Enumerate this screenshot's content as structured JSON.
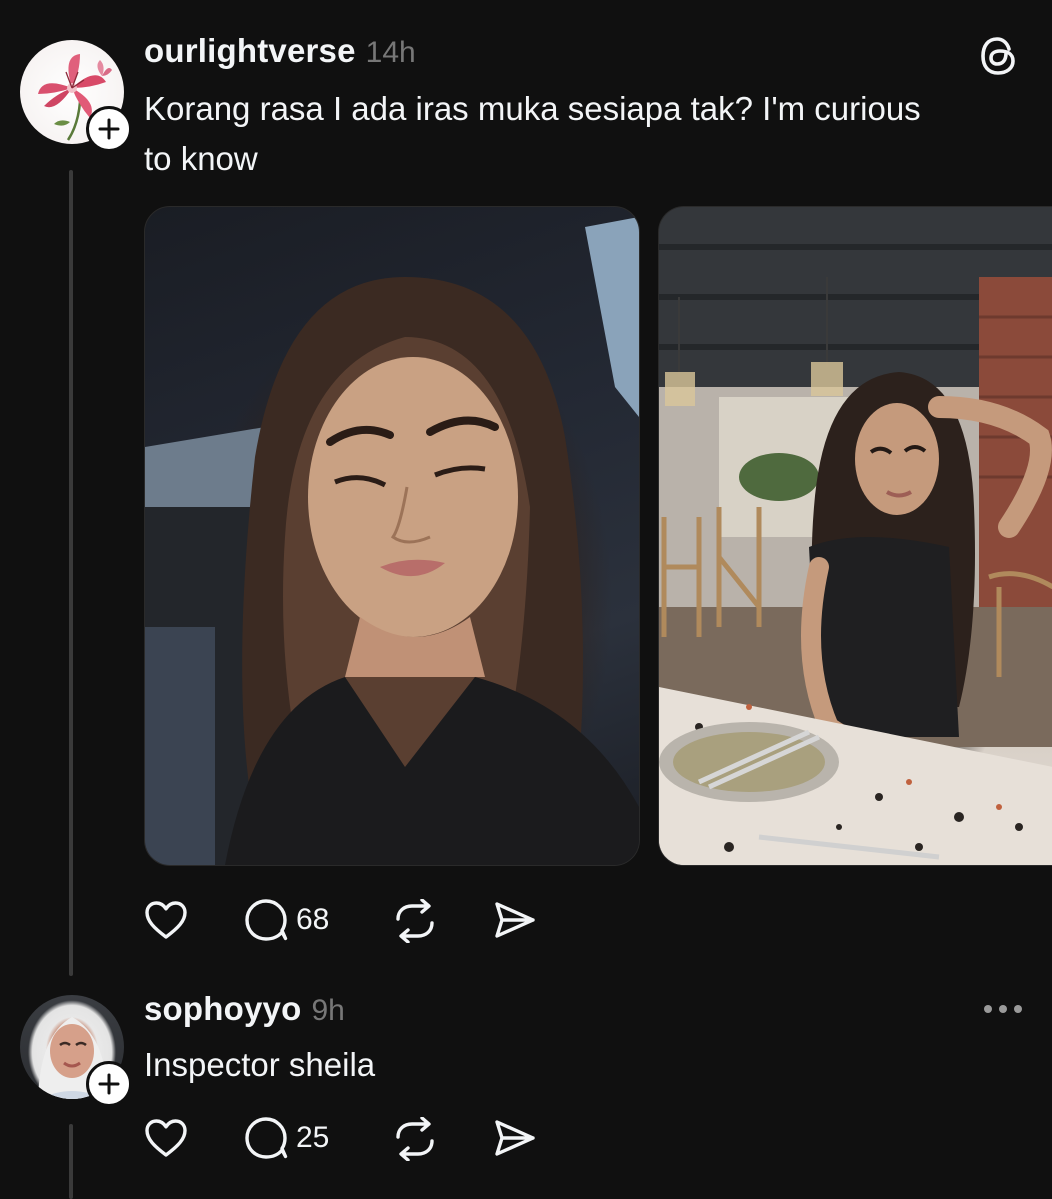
{
  "post1": {
    "username": "ourlightverse",
    "time": "14h",
    "text_line1": "Korang rasa I ada iras muka sesiapa tak? I'm curious",
    "text_line2": "to know",
    "avatar_icon": "lily-flower-avatar",
    "images": [
      {
        "name": "selfie-in-car-photo"
      },
      {
        "name": "restaurant-photo"
      }
    ],
    "actions": {
      "like_icon": "heart-icon",
      "reply_icon": "comment-icon",
      "reply_count": "68",
      "repost_icon": "repost-icon",
      "share_icon": "send-icon"
    }
  },
  "post2": {
    "username": "sophoyyo",
    "time": "9h",
    "text": "Inspector sheila",
    "actions": {
      "reply_count": "25"
    }
  },
  "colors": {
    "background": "#101010",
    "text": "#f3f5f7",
    "muted": "#777777",
    "thread_line": "#3a3a3a"
  }
}
